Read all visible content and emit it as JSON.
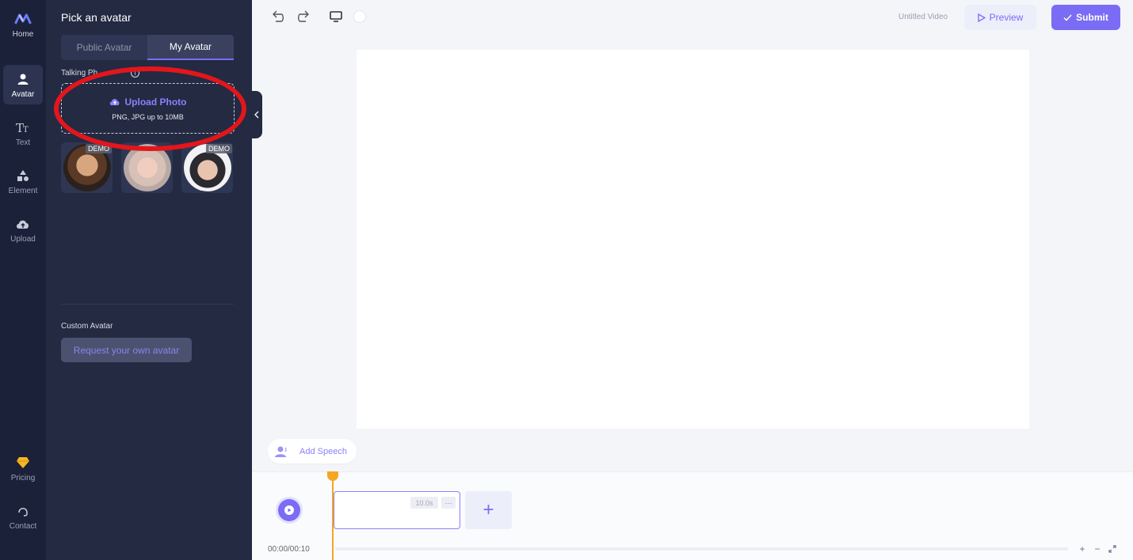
{
  "rail": {
    "home_label": "Home",
    "items": [
      {
        "label": "Avatar",
        "icon": "person-icon"
      },
      {
        "label": "Text",
        "icon": "text-icon"
      },
      {
        "label": "Element",
        "icon": "shapes-icon"
      },
      {
        "label": "Upload",
        "icon": "cloud-upload-icon"
      }
    ],
    "pricing_label": "Pricing",
    "contact_label": "Contact"
  },
  "panel": {
    "title": "Pick an avatar",
    "tabs": [
      {
        "label": "Public Avatar",
        "active": false
      },
      {
        "label": "My Avatar",
        "active": true
      }
    ],
    "talking_photo_label": "Talking Ph",
    "upload": {
      "label": "Upload Photo",
      "hint": "PNG, JPG up to 10MB"
    },
    "avatars": [
      {
        "badge": "DEMO"
      },
      {
        "badge": ""
      },
      {
        "badge": "DEMO"
      }
    ],
    "custom_avatar_label": "Custom Avatar",
    "request_button": "Request your own avatar"
  },
  "topbar": {
    "video_title": "Untitled Video",
    "preview_label": "Preview",
    "submit_label": "Submit"
  },
  "speech": {
    "add_label": "Add Speech"
  },
  "timeline": {
    "clip_duration": "10.0s",
    "clip_more": "···",
    "time_readout": "00:00/00:10"
  },
  "colors": {
    "accent": "#7a6cf5",
    "rail_bg": "#1b2138",
    "panel_bg": "#232a42",
    "playhead": "#f5a623",
    "annotation": "#e3161b"
  }
}
